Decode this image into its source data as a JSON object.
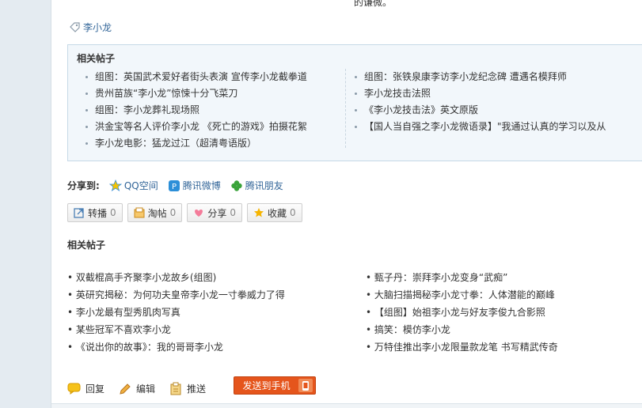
{
  "top_fragment": "的谦微。",
  "tag": {
    "label": "李小龙"
  },
  "related_box": {
    "title": "相关帖子",
    "left": [
      "组图：英国武术爱好者街头表演 宣传李小龙截拳道",
      "贵州苗族“李小龙”惊悚十分飞菜刀",
      "组图：李小龙葬礼现场照",
      "洪金宝等名人评价李小龙 《死亡的游戏》拍摄花絮",
      "李小龙电影：猛龙过江（超清粤语版）"
    ],
    "right": [
      "组图：张铁泉康李访李小龙纪念碑 遭遇名模拜师",
      "李小龙技击法照",
      "《李小龙技击法》英文原版",
      "【国人当自强之李小龙微语录】\"我通过认真的学习以及从"
    ]
  },
  "share": {
    "label": "分享到:",
    "items": [
      {
        "label": "QQ空间",
        "icon": "qzone-icon"
      },
      {
        "label": "腾讯微博",
        "icon": "tencent-weibo-icon"
      },
      {
        "label": "腾讯朋友",
        "icon": "tencent-friends-icon"
      }
    ]
  },
  "buttons": [
    {
      "label": "转播",
      "count": "0",
      "icon": "forward-icon"
    },
    {
      "label": "淘帖",
      "count": "0",
      "icon": "collect-box-icon"
    },
    {
      "label": "分享",
      "count": "0",
      "icon": "heart-icon"
    },
    {
      "label": "收藏",
      "count": "0",
      "icon": "star-icon"
    }
  ],
  "related2": {
    "title": "相关帖子",
    "left": [
      "双截棍高手齐聚李小龙故乡(组图)",
      "英研究揭秘：为何功夫皇帝李小龙一寸拳威力了得",
      "李小龙最有型秀肌肉写真",
      "某些冠军不喜欢李小龙",
      "《说出你的故事》：我的哥哥李小龙"
    ],
    "right": [
      "甄子丹：崇拜李小龙变身“武痴”",
      "大脑扫描揭秘李小龙寸拳：人体潜能的巅峰",
      "【组图】始祖李小龙与好友李俊九合影照",
      "搞笑：模仿李小龙",
      "万特佳推出李小龙限量款龙笔 书写精武传奇"
    ]
  },
  "actions": {
    "reply": "回复",
    "edit": "编辑",
    "push": "推送",
    "send_phone": "发送到手机"
  },
  "colors": {
    "link": "#336699",
    "box_bg": "#f2f7fb",
    "box_border": "#c6d9e7",
    "send_btn": "#e5551c"
  }
}
